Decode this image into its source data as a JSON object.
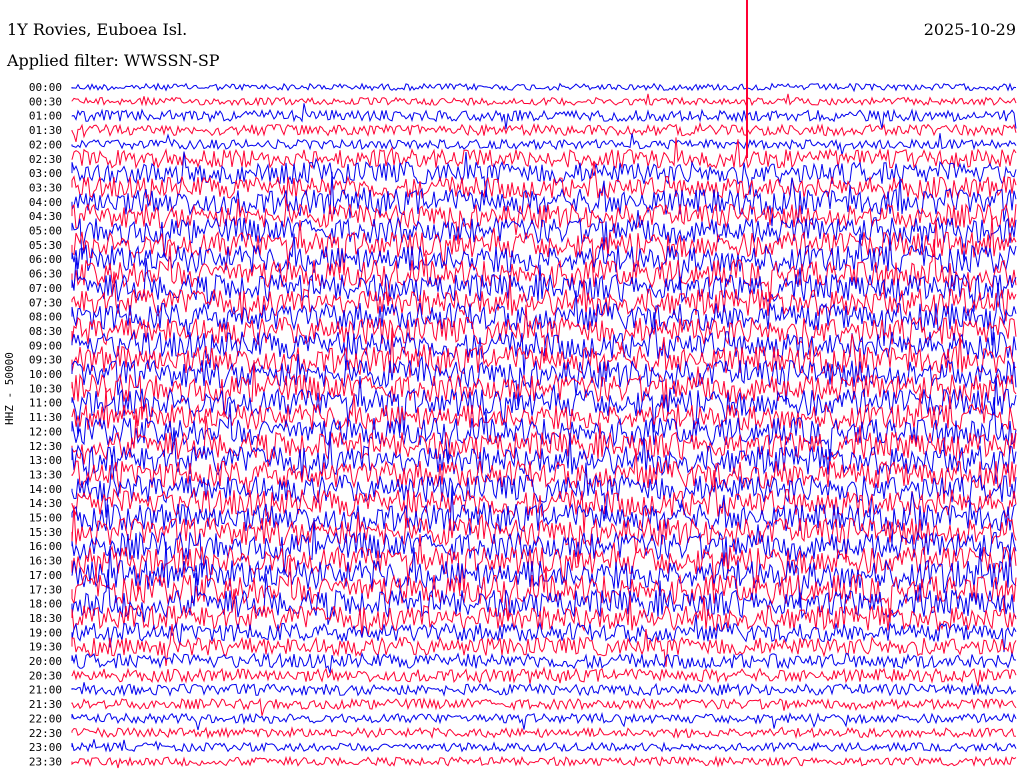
{
  "header": {
    "station": "1Y Rovies, Euboea Isl.",
    "filter": "Applied filter: WWSSN-SP",
    "date": "2025-10-29"
  },
  "chart_data": {
    "type": "line",
    "ylabel": "HHZ - 50000",
    "colors": {
      "odd": "#0000ee",
      "even": "#ff0033"
    },
    "time_labels": [
      "00:00",
      "00:30",
      "01:00",
      "01:30",
      "02:00",
      "02:30",
      "03:00",
      "03:30",
      "04:00",
      "04:30",
      "05:00",
      "05:30",
      "06:00",
      "06:30",
      "07:00",
      "07:30",
      "08:00",
      "08:30",
      "09:00",
      "09:30",
      "10:00",
      "10:30",
      "11:00",
      "11:30",
      "12:00",
      "12:30",
      "13:00",
      "13:30",
      "14:00",
      "14:30",
      "15:00",
      "15:30",
      "16:00",
      "16:30",
      "17:00",
      "17:30",
      "18:00",
      "18:30",
      "19:00",
      "19:30",
      "20:00",
      "20:30",
      "21:00",
      "21:30",
      "22:00",
      "22:30",
      "23:00",
      "23:30"
    ],
    "noise_level": [
      0.15,
      0.2,
      0.4,
      0.4,
      0.3,
      0.8,
      1.0,
      1.0,
      1.2,
      1.1,
      1.2,
      1.2,
      1.3,
      1.3,
      1.3,
      1.3,
      1.3,
      1.3,
      1.3,
      1.3,
      1.3,
      1.3,
      1.3,
      1.2,
      1.3,
      1.3,
      1.4,
      1.3,
      1.3,
      1.3,
      1.3,
      1.3,
      1.3,
      1.3,
      1.4,
      1.4,
      1.3,
      1.2,
      0.8,
      0.8,
      0.6,
      0.5,
      0.4,
      0.35,
      0.3,
      0.3,
      0.25,
      0.25
    ]
  }
}
